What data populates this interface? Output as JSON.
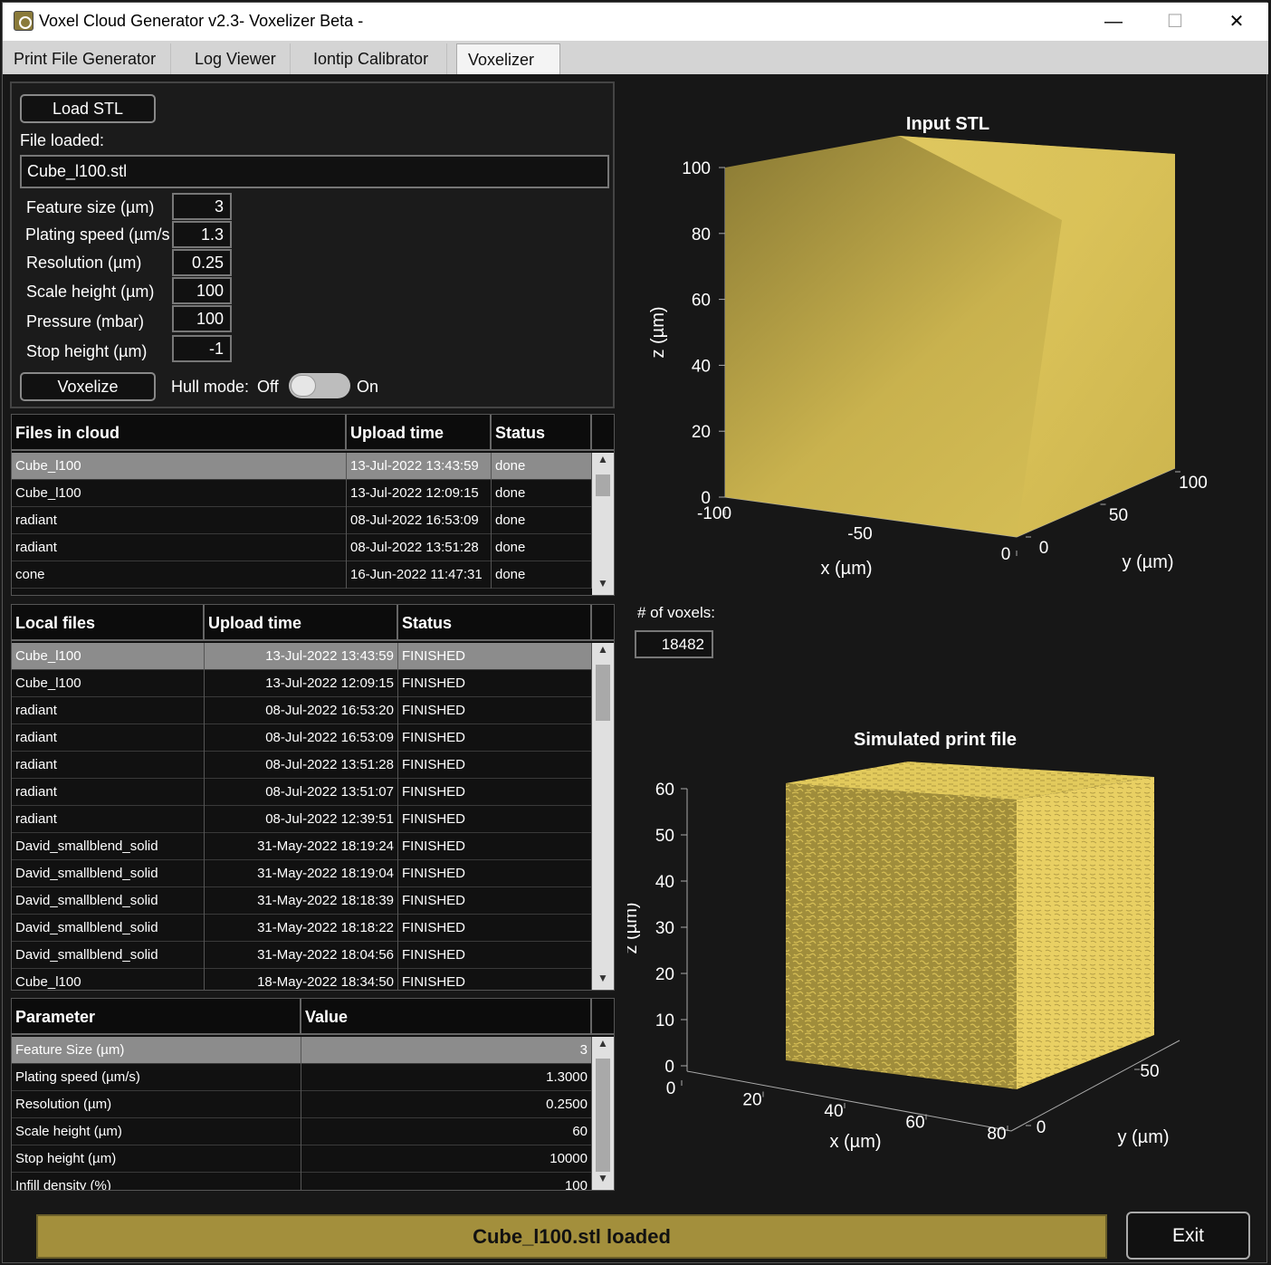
{
  "window": {
    "title": "Voxel Cloud Generator v2.3- Voxelizer Beta -",
    "minimize": "—",
    "maximize": "☐",
    "close": "✕"
  },
  "tabs": [
    "Print File Generator",
    "Log Viewer",
    "Iontip Calibrator",
    "Voxelizer"
  ],
  "controls": {
    "load_button": "Load STL",
    "file_loaded_label": "File loaded:",
    "file_loaded_value": "Cube_l100.stl",
    "params": [
      {
        "label": "Feature size (µm)",
        "value": "3"
      },
      {
        "label": "Plating speed (µm/s",
        "value": "1.3"
      },
      {
        "label": "Resolution (µm)",
        "value": "0.25"
      },
      {
        "label": "Scale height (µm)",
        "value": "100"
      },
      {
        "label": "Pressure (mbar)",
        "value": "100"
      },
      {
        "label": "Stop height (µm)",
        "value": "-1"
      }
    ],
    "voxelize_button": "Voxelize",
    "hull_mode_label": "Hull mode:",
    "hull_off": "Off",
    "hull_on": "On",
    "hull_mode_state": "off"
  },
  "cloud_table": {
    "headers": [
      "Files in cloud",
      "Upload time",
      "Status"
    ],
    "rows": [
      [
        "Cube_l100",
        "13-Jul-2022 13:43:59",
        "done"
      ],
      [
        "Cube_l100",
        "13-Jul-2022 12:09:15",
        "done"
      ],
      [
        "radiant",
        "08-Jul-2022 16:53:09",
        "done"
      ],
      [
        "radiant",
        "08-Jul-2022 13:51:28",
        "done"
      ],
      [
        "cone",
        "16-Jun-2022 11:47:31",
        "done"
      ]
    ]
  },
  "local_table": {
    "headers": [
      "Local files",
      "Upload time",
      "Status"
    ],
    "rows": [
      [
        "Cube_l100",
        "13-Jul-2022 13:43:59",
        "FINISHED"
      ],
      [
        "Cube_l100",
        "13-Jul-2022 12:09:15",
        "FINISHED"
      ],
      [
        "radiant",
        "08-Jul-2022 16:53:20",
        "FINISHED"
      ],
      [
        "radiant",
        "08-Jul-2022 16:53:09",
        "FINISHED"
      ],
      [
        "radiant",
        "08-Jul-2022 13:51:28",
        "FINISHED"
      ],
      [
        "radiant",
        "08-Jul-2022 13:51:07",
        "FINISHED"
      ],
      [
        "radiant",
        "08-Jul-2022 12:39:51",
        "FINISHED"
      ],
      [
        "David_smallblend_solid",
        "31-May-2022 18:19:24",
        "FINISHED"
      ],
      [
        "David_smallblend_solid",
        "31-May-2022 18:19:04",
        "FINISHED"
      ],
      [
        "David_smallblend_solid",
        "31-May-2022 18:18:39",
        "FINISHED"
      ],
      [
        "David_smallblend_solid",
        "31-May-2022 18:18:22",
        "FINISHED"
      ],
      [
        "David_smallblend_solid",
        "31-May-2022 18:04:56",
        "FINISHED"
      ],
      [
        "Cube_l100",
        "18-May-2022 18:34:50",
        "FINISHED"
      ]
    ]
  },
  "param_table": {
    "headers": [
      "Parameter",
      "Value"
    ],
    "rows": [
      [
        "Feature Size (µm)",
        "3"
      ],
      [
        "Plating speed (µm/s)",
        "1.3000"
      ],
      [
        "Resolution (µm)",
        "0.2500"
      ],
      [
        "Scale height (µm)",
        "60"
      ],
      [
        "Stop height (µm)",
        "10000"
      ],
      [
        "Infill density (%)",
        "100"
      ]
    ]
  },
  "voxels": {
    "label": "# of voxels:",
    "value": "18482"
  },
  "chart_data": [
    {
      "type": "surface3d",
      "title": "Input STL",
      "xlabel": "x  (µm)",
      "ylabel": "y  (µm)",
      "zlabel": "z  (µm)",
      "xticks": [
        "-100",
        "-50",
        "0"
      ],
      "yticks": [
        "0",
        "50",
        "100"
      ],
      "zticks": [
        "0",
        "20",
        "40",
        "60",
        "80",
        "100"
      ],
      "xlim": [
        -100,
        0
      ],
      "ylim": [
        0,
        100
      ],
      "zlim": [
        0,
        100
      ],
      "color": "#e2cc5e"
    },
    {
      "type": "surface3d",
      "title": "Simulated print file",
      "xlabel": "x  (µm)",
      "ylabel": "y  (µm)",
      "zlabel": "z  (µm)",
      "xticks": [
        "0",
        "20",
        "40",
        "60",
        "80"
      ],
      "yticks": [
        "0",
        "50"
      ],
      "zticks": [
        "0",
        "10",
        "20",
        "30",
        "40",
        "50",
        "60"
      ],
      "xlim": [
        0,
        80
      ],
      "ylim": [
        0,
        80
      ],
      "zlim": [
        0,
        60
      ],
      "color": "#e2cc5e"
    }
  ],
  "status": {
    "message": "Cube_l100.stl loaded",
    "color": "#a38f3c"
  },
  "exit_button": "Exit"
}
